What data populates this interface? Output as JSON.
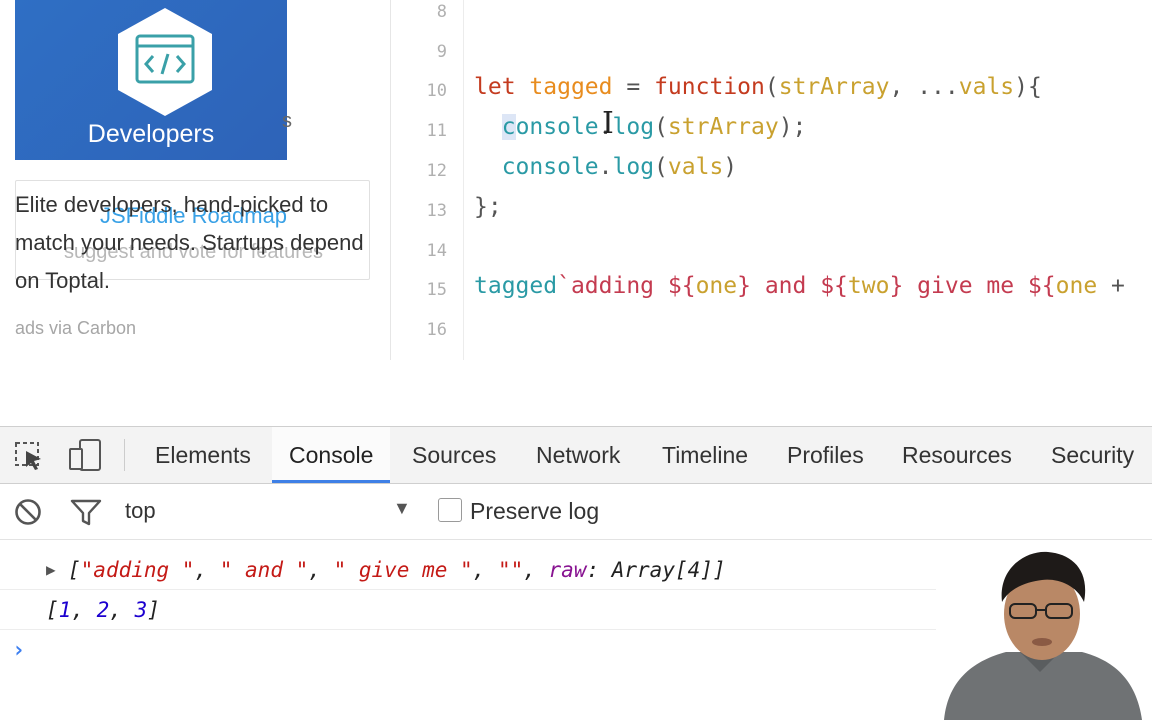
{
  "sidebar": {
    "ad_brand": "Developers",
    "ad_overflow_char": "s",
    "roadmap_title": "JSFiddle Roadmap",
    "roadmap_subtitle": "suggest and vote for features",
    "ad_text": "Elite developers, hand-picked to match your needs. Startups depend on Toptal.",
    "ads_via": "ads via Carbon"
  },
  "editor": {
    "line_numbers": [
      "8",
      "9",
      "10",
      "11",
      "12",
      "13",
      "14",
      "15",
      "16"
    ]
  },
  "devtools": {
    "tabs": [
      "Elements",
      "Console",
      "Sources",
      "Network",
      "Timeline",
      "Profiles",
      "Resources",
      "Security"
    ],
    "active_tab": "Console"
  },
  "console_toolbar": {
    "context": "top",
    "preserve_log_label": "Preserve log",
    "preserve_log_checked": false
  },
  "console_output": {
    "row1_parts": [
      "[",
      "\"adding \"",
      ", ",
      "\" and \"",
      ", ",
      "\" give me \"",
      ", ",
      "\"\"",
      ", ",
      "raw",
      ": Array[4]]"
    ],
    "row2_parts": [
      "[",
      "1",
      ", ",
      "2",
      ", ",
      "3",
      "]"
    ],
    "prompt": "›"
  },
  "colors": {
    "accent": "#3f80e6",
    "ad_background": "#2f6fc4",
    "string": "#c41a16",
    "number": "#1c00cf",
    "key": "#881391"
  }
}
